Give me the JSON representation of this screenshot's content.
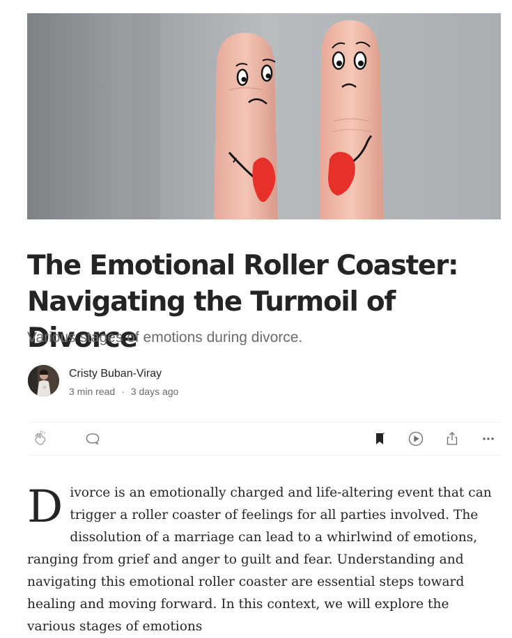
{
  "article": {
    "title": "The Emotional Roller Coaster: Navigating the Turmoil of Divorce",
    "subtitle": "Various stages of emotions during divorce.",
    "dropcap": "D",
    "body": "ivorce is an emotionally charged and life-altering event that can trigger a roller coaster of feelings for all parties involved. The dissolution of a marriage can lead to a whirlwind of emotions, ranging from grief and anger to guilt and fear. Understanding and navigating this emotional roller coaster are essential steps toward healing and moving forward. In this context, we will explore the various stages of emotions"
  },
  "author": {
    "name": "Cristy Buban-Viray",
    "read_time": "3 min read",
    "separator": "·",
    "published": "3 days ago"
  },
  "actions": {
    "icons": [
      "clap-icon",
      "comment-icon",
      "bookmark-icon",
      "listen-icon",
      "share-icon",
      "more-icon"
    ]
  },
  "colors": {
    "text": "#242424",
    "muted": "#6b6b6b",
    "divider": "#f0f0f0",
    "heart": "#e8302a"
  }
}
